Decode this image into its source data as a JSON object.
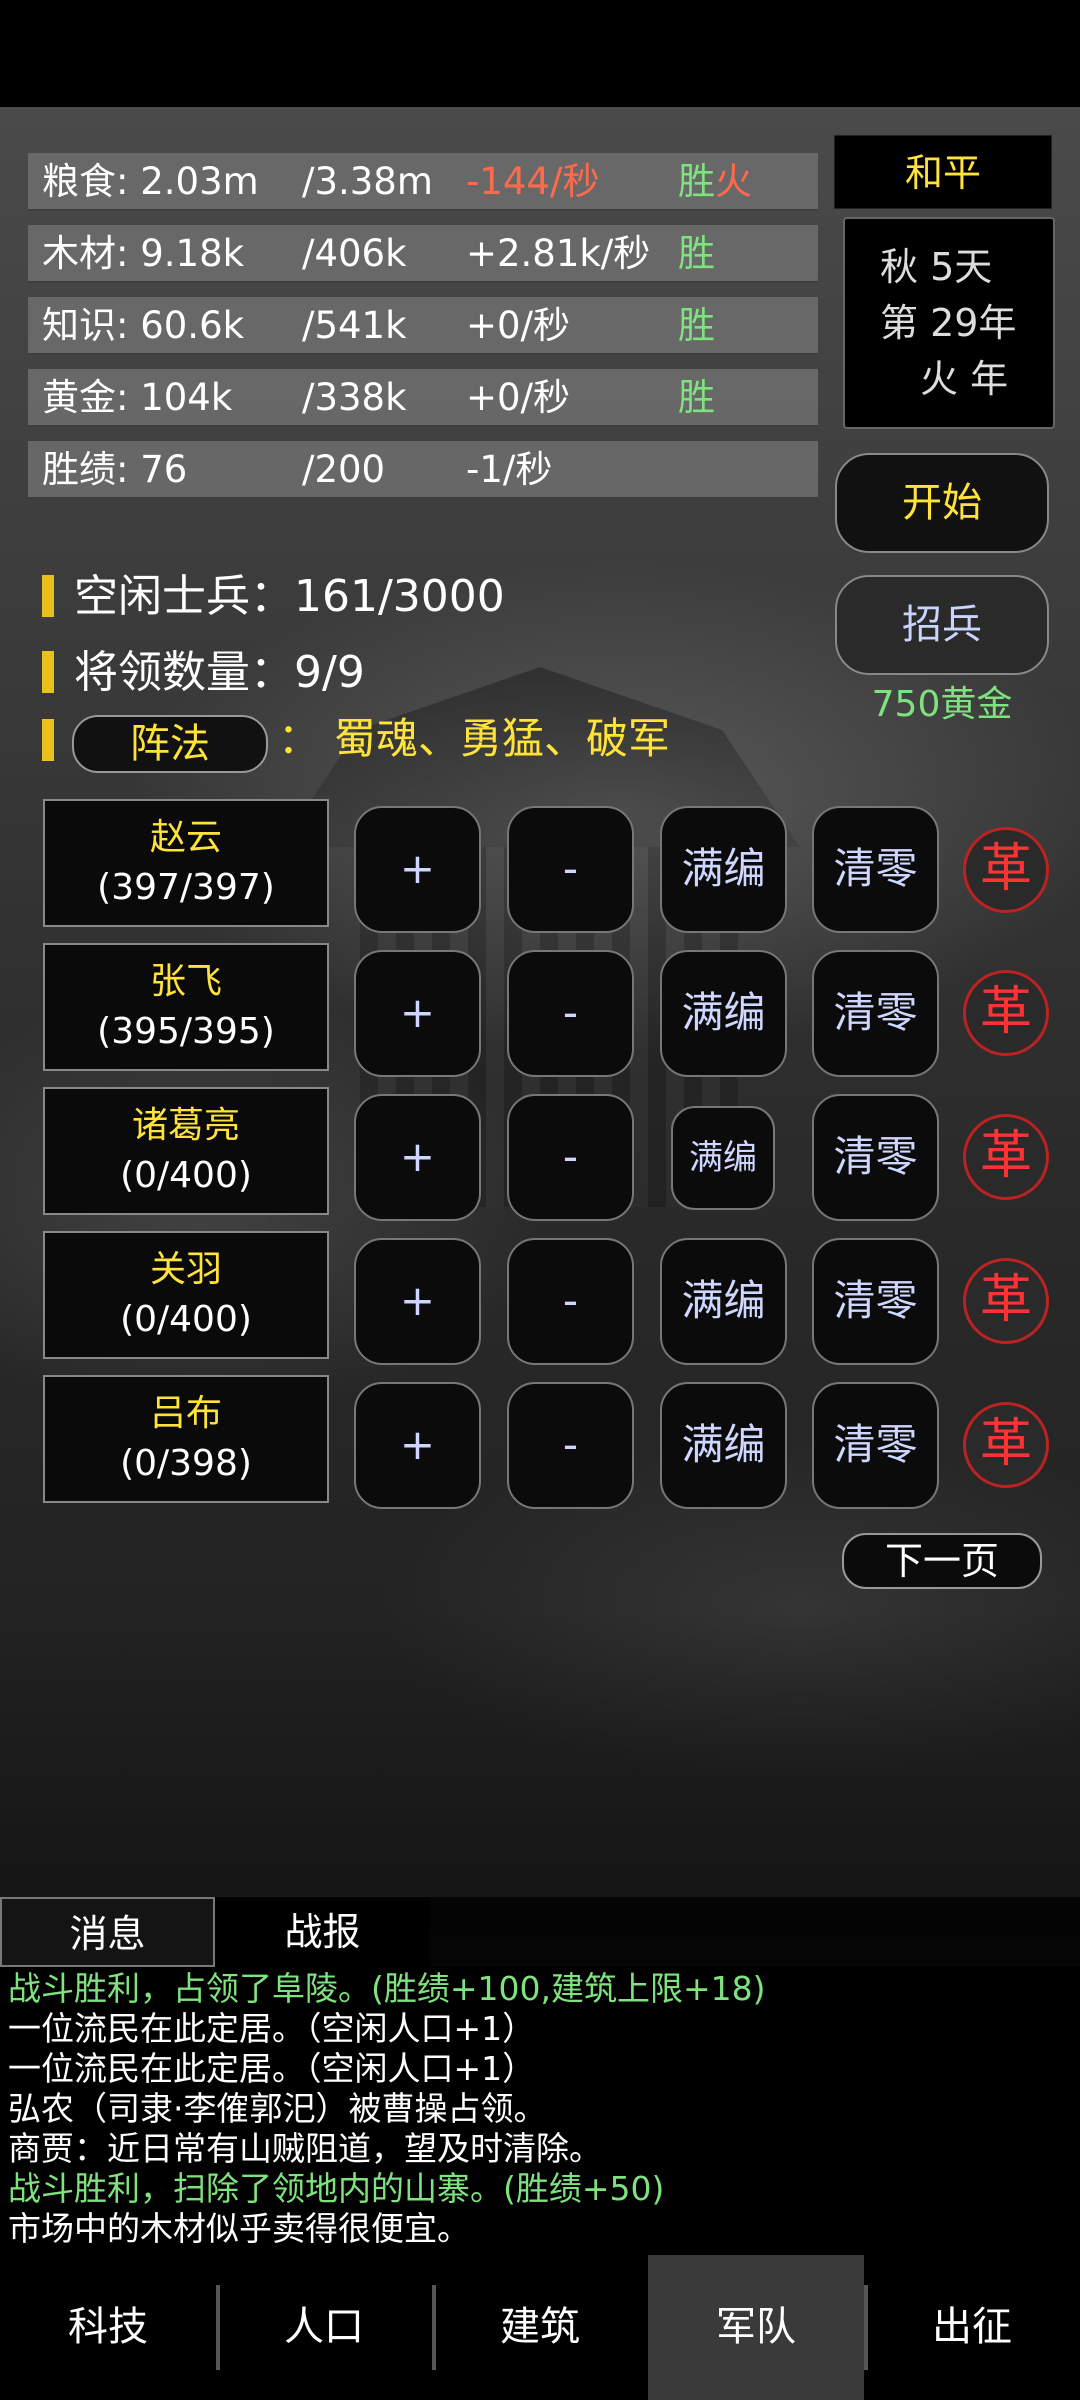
{
  "resources": [
    {
      "name": "粮食: 2.03m",
      "cap": "/3.38m",
      "rate": "-144/秒",
      "flag1": "胜",
      "flag2": "火"
    },
    {
      "name": "木材: 9.18k",
      "cap": "/406k",
      "rate": "+2.81k/秒",
      "flag1": "胜",
      "flag2": ""
    },
    {
      "name": "知识: 60.6k",
      "cap": "/541k",
      "rate": "+0/秒",
      "flag1": "胜",
      "flag2": ""
    },
    {
      "name": "黄金: 104k",
      "cap": "/338k",
      "rate": "+0/秒",
      "flag1": "胜",
      "flag2": ""
    },
    {
      "name": "胜绩: 76",
      "cap": "/200",
      "rate": "-1/秒",
      "flag1": "",
      "flag2": ""
    }
  ],
  "status": "和平",
  "date": {
    "line1": "秋 5天",
    "line2": "第 29年",
    "line3": "火 年"
  },
  "start_label": "开始",
  "recruit_label": "招兵",
  "recruit_cost": "750黄金",
  "idle_soldiers": "空闲士兵：161/3000",
  "general_count": "将领数量：9/9",
  "formation": {
    "button": "阵法",
    "colon": "：",
    "value": "蜀魂、勇猛、破军"
  },
  "generals": [
    {
      "name": "赵云",
      "count": "(397/397)"
    },
    {
      "name": "张飞",
      "count": "(395/395)"
    },
    {
      "name": "诸葛亮",
      "count": "(0/400)"
    },
    {
      "name": "关羽",
      "count": "(0/400)"
    },
    {
      "name": "吕布",
      "count": "(0/398)"
    }
  ],
  "row_buttons": {
    "add": "+",
    "sub": "-",
    "full": "满编",
    "clear": "清零",
    "ge": "革"
  },
  "next_page": "下一页",
  "tabs": {
    "messages": "消息",
    "battle": "战报"
  },
  "log": [
    {
      "text": "战斗胜利，占领了阜陵。(胜绩+100,建筑上限+18)",
      "type": "win"
    },
    {
      "text": "一位流民在此定居。（空闲人口+1）",
      "type": "normal"
    },
    {
      "text": "一位流民在此定居。（空闲人口+1）",
      "type": "normal"
    },
    {
      "text": "弘农（司隶·李傕郭汜）被曹操占领。",
      "type": "normal"
    },
    {
      "text": "商贾：近日常有山贼阻道，望及时清除。",
      "type": "normal"
    },
    {
      "text": "战斗胜利，扫除了领地内的山寨。(胜绩+50)",
      "type": "win"
    },
    {
      "text": "市场中的木材似乎卖得很便宜。",
      "type": "normal"
    }
  ],
  "nav": [
    "科技",
    "人口",
    "建筑",
    "军队",
    "出征"
  ],
  "nav_active": "军队",
  "colors": {
    "yellow": "#ffe33a",
    "green": "#7ee37e",
    "red": "#ff6a4d",
    "ge_red": "#ff3333"
  }
}
